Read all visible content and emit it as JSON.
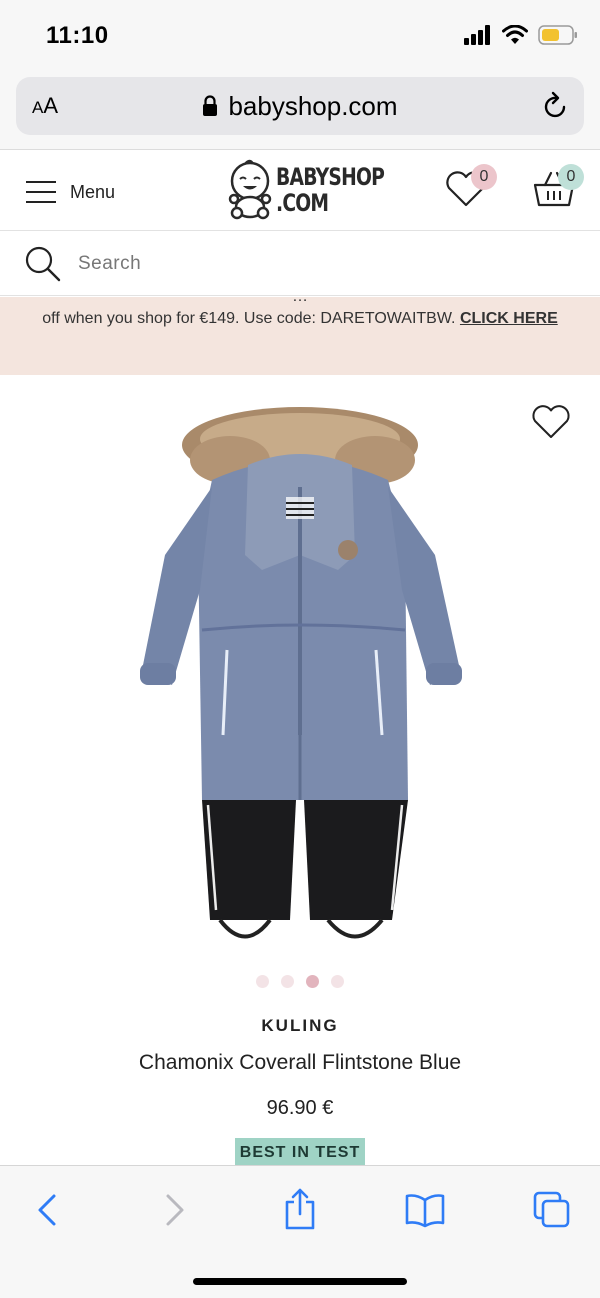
{
  "status_bar": {
    "time": "11:10"
  },
  "browser": {
    "text_size_label": "AA",
    "url": "babyshop.com"
  },
  "header": {
    "menu_label": "Menu",
    "logo_line1": "BABYSHOP",
    "logo_line2": ".COM",
    "wishlist_count": "0",
    "cart_count": "0"
  },
  "search": {
    "placeholder": "Search"
  },
  "promo": {
    "text_partial_hidden": "…",
    "text": "off when you shop for €149. Use code: DARETOWAITBW.",
    "link": "CLICK HERE"
  },
  "product": {
    "brand": "KULING",
    "name": "Chamonix Coverall Flintstone Blue",
    "price": "96.90 €",
    "badge": "BEST IN TEST",
    "image_count": 4,
    "active_image": 3
  },
  "colors": {
    "promo_bg": "#f4e5de",
    "badge_bg": "#9fd3c5",
    "wishlist_badge": "#ecc5cb",
    "cart_badge": "#bfe0d8",
    "ios_blue": "#2f7cf6"
  }
}
